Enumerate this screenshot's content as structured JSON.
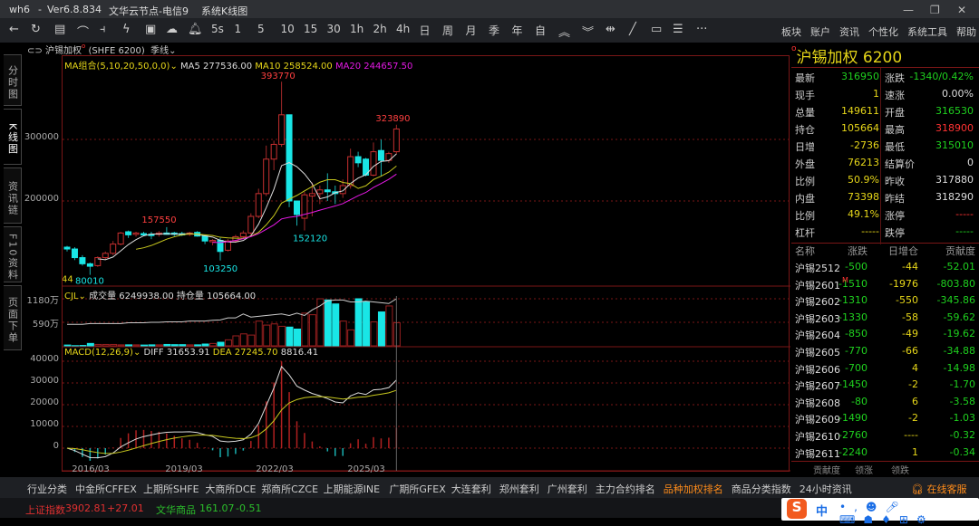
{
  "titlebar": {
    "app": "wh6",
    "version": "Ver6.8.834",
    "server": "文华云节点-电信9",
    "view": "系统K线图"
  },
  "toolbar": {
    "periods": [
      "5s",
      "1",
      "5",
      "10",
      "15",
      "30",
      "1h",
      "2h",
      "4h",
      "日",
      "周",
      "月",
      "季",
      "年",
      "自"
    ],
    "menus": [
      "板块",
      "账户",
      "资讯",
      "个性化",
      "系统工具",
      "帮助"
    ]
  },
  "symbol": {
    "name": "沪锡加权",
    "code": "(SHFE 6200)",
    "period": "季线"
  },
  "left_tabs": [
    "分时图",
    "K线图",
    "资讯链",
    "F10资料",
    "页面下单"
  ],
  "legend": {
    "ma": "MA组合(5,10,20,50,0,0)",
    "ma5": "MA5 277536.00",
    "ma10": "MA10 258524.00",
    "ma20": "MA20 244657.50",
    "vol": "CJL",
    "vol_val": "成交量 6249938.00",
    "oi_val": "持仓量 105664.00",
    "macd": "MACD(12,26,9)",
    "diff": "DIFF 31653.91",
    "dea": "DEA 27245.70",
    "macd_val": "8816.41"
  },
  "chart_data": {
    "type": "candlestick",
    "price_ticks": [
      "300000",
      "200000"
    ],
    "price_tick_values": [
      300000,
      200000
    ],
    "annotations": {
      "high": "393770",
      "recent_high": "323890",
      "low1": "157550",
      "low2": "103250",
      "low3": "152120",
      "min": "80010",
      "left_label": "44"
    },
    "volume_ticks": [
      "1180万",
      "590万"
    ],
    "macd_ticks": [
      "40000",
      "30000",
      "20000",
      "10000",
      "0"
    ],
    "x_ticks": [
      "2016/03",
      "2019/03",
      "2022/03",
      "2025/03"
    ],
    "ohlc": [
      [
        125,
        127,
        118,
        122
      ],
      [
        122,
        125,
        104,
        108
      ],
      [
        108,
        112,
        95,
        98
      ],
      [
        98,
        100,
        80.01,
        94
      ],
      [
        95,
        110,
        93,
        108
      ],
      [
        108,
        118,
        105,
        115
      ],
      [
        115,
        135,
        112,
        130
      ],
      [
        130,
        150,
        128,
        148
      ],
      [
        150,
        152,
        140,
        145
      ],
      [
        146,
        150,
        142,
        148
      ],
      [
        147,
        150,
        144,
        146
      ],
      [
        146,
        150,
        138,
        145
      ],
      [
        146,
        151,
        142,
        148
      ],
      [
        148,
        157.55,
        145,
        147
      ],
      [
        148,
        150,
        143,
        146
      ],
      [
        147,
        150,
        143,
        145
      ],
      [
        146,
        150,
        143,
        148
      ],
      [
        149,
        151,
        142,
        143
      ],
      [
        143,
        145,
        130,
        135
      ],
      [
        134,
        138,
        128,
        136
      ],
      [
        136,
        140,
        103.25,
        118
      ],
      [
        120,
        138,
        118,
        135
      ],
      [
        135,
        145,
        132,
        142
      ],
      [
        142,
        152,
        138,
        148
      ],
      [
        148,
        180,
        145,
        175
      ],
      [
        175,
        220,
        172,
        212
      ],
      [
        212,
        290,
        208,
        268
      ],
      [
        268,
        298,
        250,
        292
      ],
      [
        292,
        393.77,
        288,
        340
      ],
      [
        340,
        340,
        190,
        200
      ],
      [
        200,
        200,
        160,
        178
      ],
      [
        172,
        215,
        152.12,
        210
      ],
      [
        208,
        230,
        175,
        212
      ],
      [
        212,
        225,
        195,
        218
      ],
      [
        218,
        245,
        200,
        215
      ],
      [
        215,
        225,
        195,
        212
      ],
      [
        212,
        235,
        205,
        225
      ],
      [
        225,
        285,
        220,
        272
      ],
      [
        272,
        280,
        255,
        262
      ],
      [
        268,
        270,
        240,
        242
      ],
      [
        242,
        295,
        240,
        280
      ],
      [
        282,
        300,
        240,
        266
      ],
      [
        266,
        280,
        262,
        277
      ],
      [
        280,
        323.89,
        276,
        317
      ]
    ],
    "volume": [
      20,
      5,
      10,
      60,
      35,
      35,
      35,
      25,
      25,
      25,
      20,
      25,
      25,
      35,
      30,
      30,
      25,
      25,
      45,
      60,
      90,
      150,
      250,
      300,
      270,
      620,
      520,
      550,
      490,
      470,
      420,
      820,
      780,
      1180,
      1150,
      1050,
      620,
      400,
      1180,
      1110,
      600,
      850,
      1000,
      580
    ],
    "oi": [
      540,
      540,
      540,
      560,
      560,
      560,
      560,
      560,
      580,
      580,
      580,
      590,
      590,
      600,
      600,
      600,
      620,
      620,
      620,
      640,
      650,
      700,
      700,
      800,
      720,
      740,
      760,
      780,
      800,
      760,
      820,
      760,
      900,
      1000,
      1130,
      1150,
      1150,
      1100,
      1100,
      1120,
      1100,
      1080,
      1060,
      1180
    ]
  },
  "quote": {
    "title": "沪锡加权",
    "code": "6200",
    "left": [
      {
        "k": "最新",
        "v": "316950",
        "c": "g"
      },
      {
        "k": "现手",
        "v": "1",
        "c": "y"
      },
      {
        "k": "总量",
        "v": "149611",
        "c": "y"
      },
      {
        "k": "持仓",
        "v": "105664",
        "c": "y"
      },
      {
        "k": "日增",
        "v": "-2736",
        "c": "y"
      },
      {
        "k": "外盘",
        "v": "76213",
        "c": "y"
      },
      {
        "k": "比例",
        "v": "50.9%",
        "c": "y"
      },
      {
        "k": "内盘",
        "v": "73398",
        "c": "y"
      },
      {
        "k": "比例",
        "v": "49.1%",
        "c": "y"
      },
      {
        "k": "杠杆",
        "v": "-----",
        "c": "y"
      }
    ],
    "right": [
      {
        "k": "涨跌",
        "v": "-1340/0.42%",
        "c": "g"
      },
      {
        "k": "速涨",
        "v": "0.00%",
        "c": "w"
      },
      {
        "k": "开盘",
        "v": "316530",
        "c": "g"
      },
      {
        "k": "最高",
        "v": "318900",
        "c": "r"
      },
      {
        "k": "最低",
        "v": "315010",
        "c": "g"
      },
      {
        "k": "结算价",
        "v": "0",
        "c": "w"
      },
      {
        "k": "昨收",
        "v": "317880",
        "c": "w"
      },
      {
        "k": "昨结",
        "v": "318290",
        "c": "w"
      },
      {
        "k": "涨停",
        "v": "-----",
        "c": "r"
      },
      {
        "k": "跌停",
        "v": "-----",
        "c": "g"
      }
    ]
  },
  "contrib": {
    "headers": [
      "名称",
      "涨跌",
      "日增仓",
      "贡献度"
    ],
    "rows": [
      [
        "沪锡2512",
        "-500",
        "-44",
        "-52.01"
      ],
      [
        "沪锡2601",
        "-1510",
        "-1976",
        "-803.80"
      ],
      [
        "沪锡2602",
        "-1310",
        "-550",
        "-345.86"
      ],
      [
        "沪锡2603",
        "-1330",
        "-58",
        "-59.62"
      ],
      [
        "沪锡2604",
        "-850",
        "-49",
        "-19.62"
      ],
      [
        "沪锡2605",
        "-770",
        "-66",
        "-34.88"
      ],
      [
        "沪锡2606",
        "-700",
        "4",
        "-14.98"
      ],
      [
        "沪锡2607",
        "-1450",
        "-2",
        "-1.70"
      ],
      [
        "沪锡2608",
        "-80",
        "6",
        "-3.58"
      ],
      [
        "沪锡2609",
        "-1490",
        "-2",
        "-1.03"
      ],
      [
        "沪锡2610",
        "-2760",
        "----",
        "-0.32"
      ],
      [
        "沪锡2611",
        "-2240",
        "1",
        "-0.34"
      ]
    ],
    "main_badge": "M",
    "tabs": [
      "贡献度",
      "领涨",
      "领跌"
    ]
  },
  "bottom_tabs": [
    "行业分类",
    "中金所CFFEX",
    "上期所SHFE",
    "大商所DCE",
    "郑商所CZCE",
    "上期能源INE",
    "广期所GFEX",
    "大连套利",
    "郑州套利",
    "广州套利",
    "主力合约排名",
    "品种加权排名",
    "商品分类指数",
    "24小时资讯"
  ],
  "service": "在线客服",
  "status": {
    "idx1_name": "上证指数",
    "idx1_val": "3902.81",
    "idx1_chg": "+27.01",
    "idx2_name": "文华商品",
    "idx2_val": "161.07",
    "idx2_chg": "-0.51"
  },
  "ime": {
    "mode": "中"
  },
  "colors": {
    "up": "#ff3333",
    "down": "#19e6e6",
    "frame": "#7a1616",
    "ma5": "#dddddd",
    "ma10": "#c8c81e",
    "ma20": "#e619e6"
  }
}
